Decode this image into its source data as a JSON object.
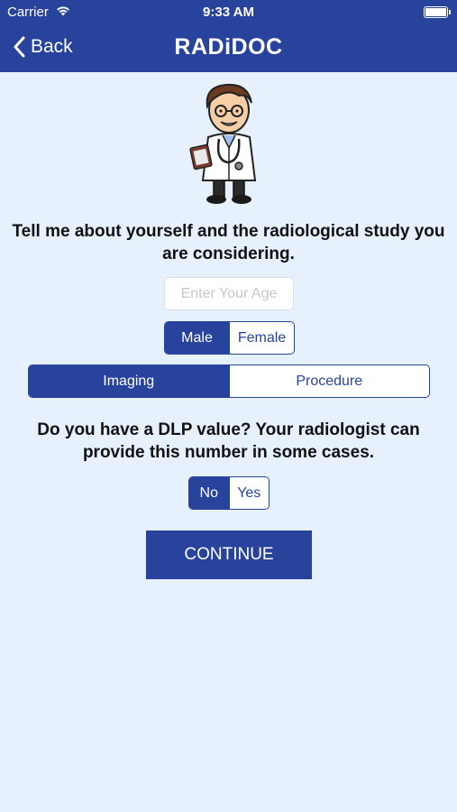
{
  "status_bar": {
    "carrier": "Carrier",
    "time": "9:33 AM",
    "wifi_icon": "wifi-icon",
    "battery_icon": "battery-icon"
  },
  "nav": {
    "back_label": "Back",
    "title": "RADiDOC",
    "back_icon": "chevron-left-icon"
  },
  "mascot": {
    "icon": "doctor-mascot"
  },
  "intro_text": "Tell me about yourself and the radiological study you are considering.",
  "age_input": {
    "placeholder": "Enter Your Age",
    "value": ""
  },
  "gender": {
    "options": [
      "Male",
      "Female"
    ],
    "selected": "Male"
  },
  "study_type": {
    "options": [
      "Imaging",
      "Procedure"
    ],
    "selected": "Imaging"
  },
  "dlp_question": "Do you have a DLP value? Your radiologist can provide this number in some cases.",
  "dlp": {
    "options": [
      "No",
      "Yes"
    ],
    "selected": "No"
  },
  "continue_label": "CONTINUE",
  "colors": {
    "nav": "#28439c",
    "accent": "#28439c",
    "background": "#e6f1fd"
  }
}
